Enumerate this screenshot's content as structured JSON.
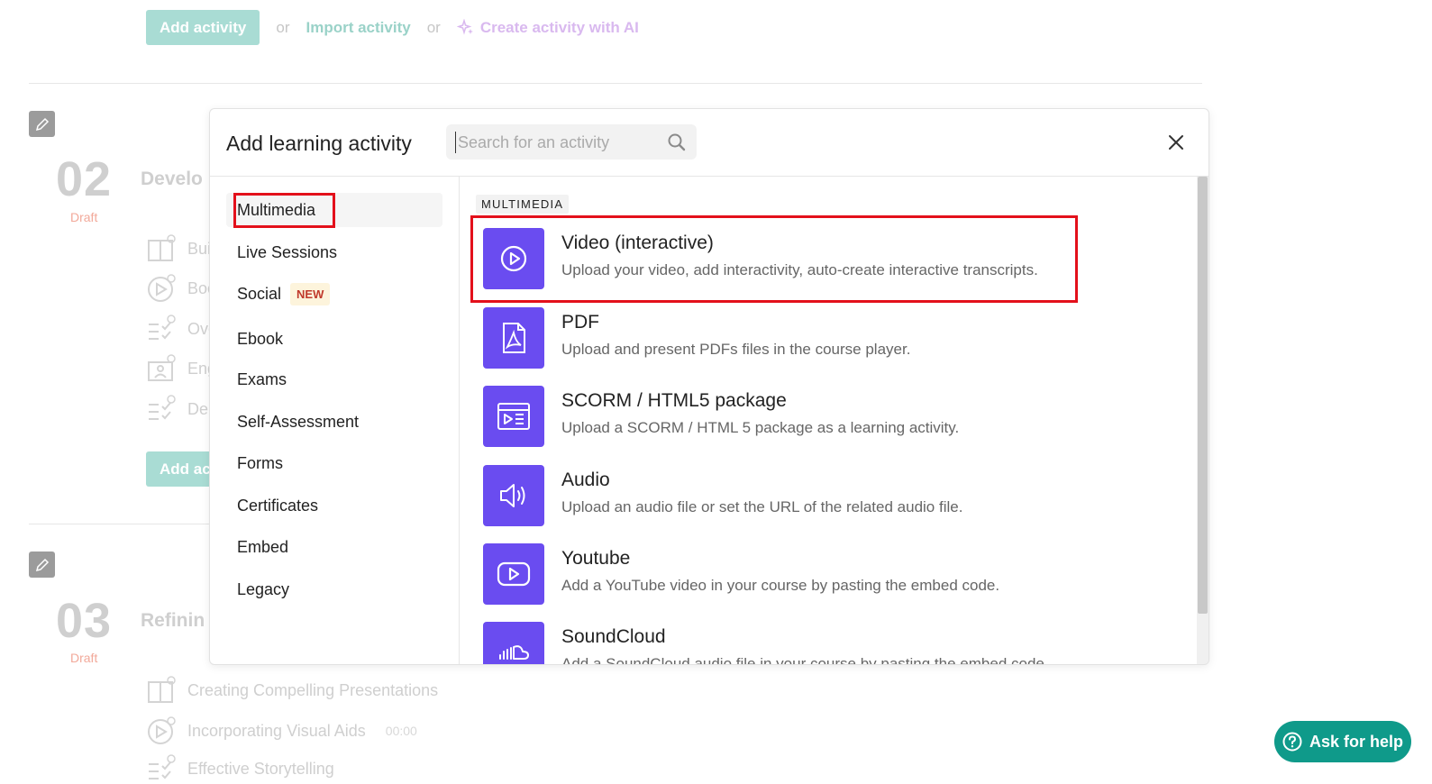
{
  "background": {
    "top_bar": {
      "add_label": "Add activity",
      "or1": "or",
      "import_label": "Import activity",
      "or2": "or",
      "ai_label": "Create activity with AI"
    },
    "sections": [
      {
        "number": "02",
        "status": "Draft",
        "title": "Develo",
        "activities": [
          {
            "label": "Bui",
            "icon": "ebook-icon"
          },
          {
            "label": "Boo",
            "icon": "video-icon"
          },
          {
            "label": "Ove",
            "icon": "checklist-icon"
          },
          {
            "label": "Eng",
            "icon": "contact-icon"
          },
          {
            "label": "Del",
            "icon": "checklist-icon"
          }
        ],
        "add_label": "Add ac"
      },
      {
        "number": "03",
        "status": "Draft",
        "title": "Refinin",
        "activities": [
          {
            "label": "Creating Compelling Presentations",
            "icon": "ebook-icon"
          },
          {
            "label": "Incorporating Visual Aids",
            "time": "00:00",
            "icon": "video-icon"
          },
          {
            "label": "Effective Storytelling",
            "icon": "checklist-icon"
          }
        ]
      }
    ]
  },
  "modal": {
    "title": "Add learning activity",
    "search_placeholder": "Search for an activity",
    "close_icon": "close-icon",
    "categories": [
      {
        "label": "Multimedia",
        "active": true
      },
      {
        "label": "Live Sessions"
      },
      {
        "label": "Social",
        "badge": "NEW"
      },
      {
        "label": "Ebook"
      },
      {
        "label": "Exams"
      },
      {
        "label": "Self-Assessment"
      },
      {
        "label": "Forms"
      },
      {
        "label": "Certificates"
      },
      {
        "label": "Embed"
      },
      {
        "label": "Legacy"
      }
    ],
    "section_heading": "MULTIMEDIA",
    "activities": [
      {
        "title": "Video (interactive)",
        "desc": "Upload your video, add interactivity, auto-create interactive transcripts.",
        "icon": "play-circle-icon"
      },
      {
        "title": "PDF",
        "desc": "Upload and present PDFs files in the course player.",
        "icon": "pdf-icon"
      },
      {
        "title": "SCORM / HTML5 package",
        "desc": "Upload a SCORM / HTML 5 package as a learning activity.",
        "icon": "scorm-icon"
      },
      {
        "title": "Audio",
        "desc": "Upload an audio file or set the URL of the related audio file.",
        "icon": "speaker-icon"
      },
      {
        "title": "Youtube",
        "desc": "Add a YouTube video in your course by pasting the embed code.",
        "icon": "youtube-icon"
      },
      {
        "title": "SoundCloud",
        "desc": "Add a SoundCloud audio file in your course by pasting the embed code.",
        "icon": "soundcloud-icon"
      }
    ],
    "accent_color": "#6a4cf0",
    "highlight_color": "#e3101b"
  },
  "help": {
    "label": "Ask for help",
    "color": "#0f9a8a"
  }
}
